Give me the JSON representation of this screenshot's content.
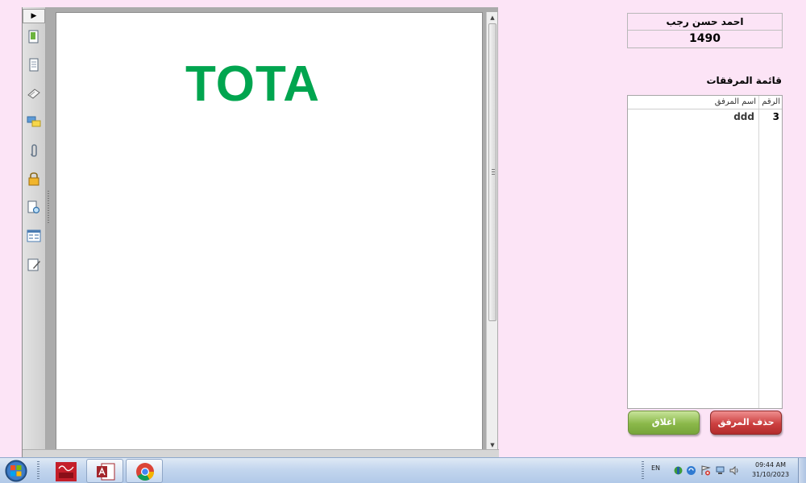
{
  "viewer": {
    "nav_toggle_icon": "triangle-right-icon",
    "nav_icons": [
      "pages-icon",
      "document-icon",
      "signature-icon",
      "comment-icon",
      "attachment-icon",
      "lock-icon",
      "document-search-icon",
      "form-icon",
      "edit-icon"
    ],
    "document_title": "TOTA"
  },
  "record": {
    "person_name": "احمد حسن رجب",
    "number": "1490"
  },
  "attachments": {
    "title": "قائمة المرفقات",
    "columns": {
      "number": "الرقم",
      "name": "اسم المرفق"
    },
    "rows": [
      {
        "number": "3",
        "name": "ddd"
      }
    ]
  },
  "buttons": {
    "close": "اغلاق",
    "delete": "حذف المرفق"
  },
  "taskbar": {
    "apps": [
      "rt-tool",
      "microsoft-access",
      "google-chrome"
    ],
    "language": "EN",
    "time": "09:44 AM",
    "date": "31/10/2023"
  },
  "colors": {
    "background": "#fce4f6",
    "title_green": "#00a54f",
    "close_button": "#8bb84a",
    "delete_button": "#cc4040"
  }
}
